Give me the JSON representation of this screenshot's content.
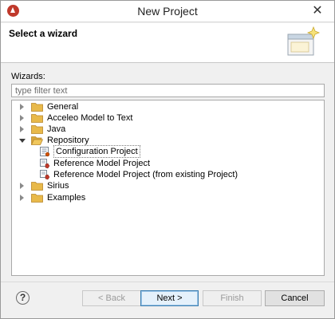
{
  "window": {
    "title": "New Project"
  },
  "banner": {
    "title": "Select a wizard"
  },
  "wizards": {
    "label": "Wizards:",
    "filter_placeholder": "type filter text"
  },
  "tree": {
    "items": [
      {
        "label": "General",
        "expanded": false,
        "icon": "folder-icon"
      },
      {
        "label": "Acceleo Model to Text",
        "expanded": false,
        "icon": "folder-icon"
      },
      {
        "label": "Java",
        "expanded": false,
        "icon": "folder-icon"
      },
      {
        "label": "Repository",
        "expanded": true,
        "icon": "folder-open-icon"
      },
      {
        "label": "Configuration Project",
        "icon": "configuration-project-icon",
        "selected": true
      },
      {
        "label": "Reference Model Project",
        "icon": "reference-model-icon"
      },
      {
        "label": "Reference Model Project (from existing Project)",
        "icon": "reference-model-icon"
      },
      {
        "label": "Sirius",
        "expanded": false,
        "icon": "folder-icon"
      },
      {
        "label": "Examples",
        "expanded": false,
        "icon": "folder-icon"
      }
    ]
  },
  "buttons": {
    "back": "< Back",
    "next": "Next >",
    "finish": "Finish",
    "cancel": "Cancel",
    "help": "?"
  },
  "colors": {
    "app_icon": "#c0392b",
    "folder": "#e8b94a",
    "default_button_border": "#3c7fb1"
  }
}
